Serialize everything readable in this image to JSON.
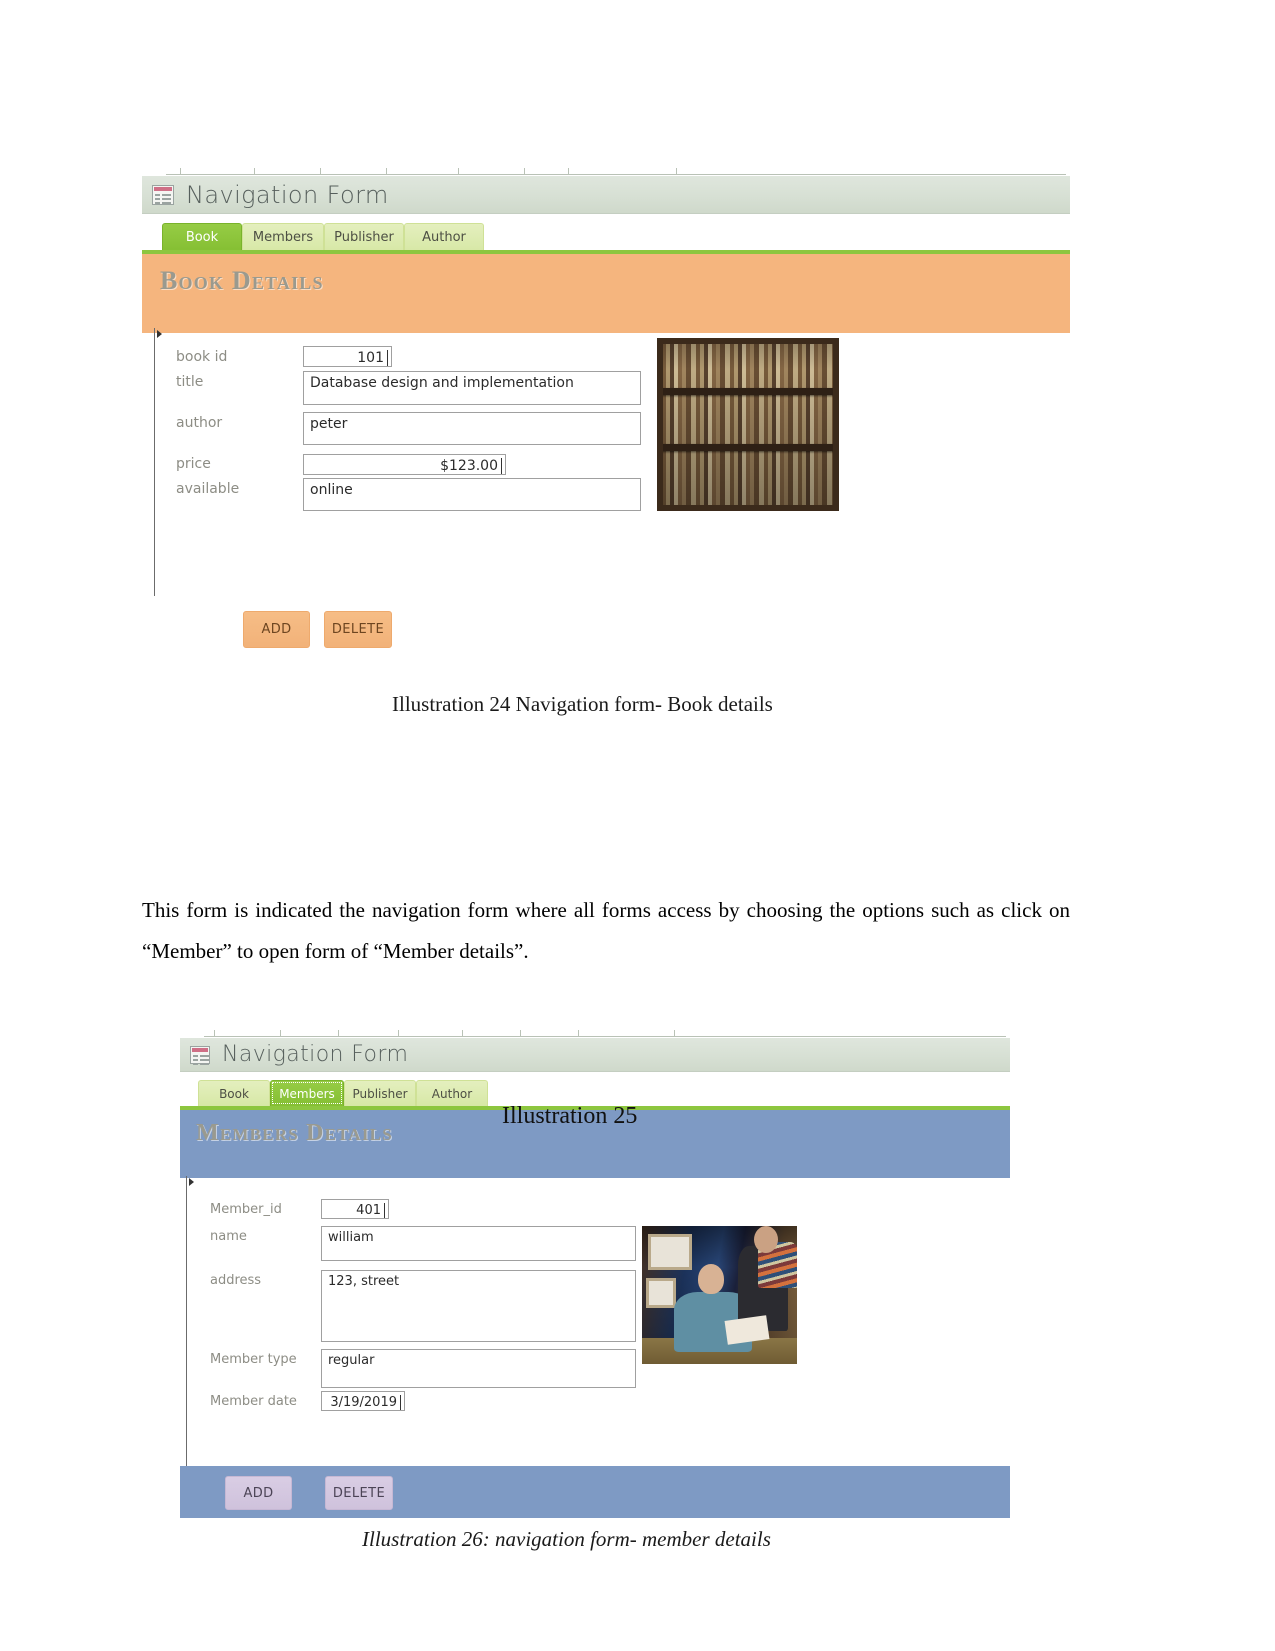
{
  "document": {
    "paragraph": "This form is indicated the navigation form where all forms access by choosing the options such as click on “Member”  to open form of “Member details”.",
    "caption_book": "Illustration 24 Navigation form- Book details",
    "caption_member": "Illustration 26: navigation form- member details",
    "overlay_illustration": "Illustration 25"
  },
  "book_form": {
    "window_title": "Navigation Form",
    "window_icon": "form-window-icon",
    "tabs": [
      {
        "label": "Book",
        "active": true
      },
      {
        "label": "Members",
        "active": false
      },
      {
        "label": "Publisher",
        "active": false
      },
      {
        "label": "Author",
        "active": false
      }
    ],
    "header_title": "Book Details",
    "header_color": "#f5b57e",
    "accent_color": "#8dc63f",
    "fields": [
      {
        "label": "book id",
        "value": "101",
        "align": "right"
      },
      {
        "label": "title",
        "value": "Database design and implementation",
        "align": "left"
      },
      {
        "label": "author",
        "value": "peter",
        "align": "left"
      },
      {
        "label": "price",
        "value": "$123.00",
        "align": "right"
      },
      {
        "label": "available",
        "value": "online",
        "align": "left"
      }
    ],
    "image_alt": "bookshelf-photo",
    "buttons": [
      {
        "label": "ADD"
      },
      {
        "label": "DELETE"
      }
    ]
  },
  "member_form": {
    "window_title": "Navigation Form",
    "window_icon": "form-window-icon",
    "tabs": [
      {
        "label": "Book",
        "active": false
      },
      {
        "label": "Members",
        "active": true
      },
      {
        "label": "Publisher",
        "active": false
      },
      {
        "label": "Author",
        "active": false
      }
    ],
    "header_title": "Members Details",
    "header_color": "#7e9ac4",
    "accent_color": "#8dc63f",
    "fields": [
      {
        "label": "Member_id",
        "value": "401",
        "align": "right"
      },
      {
        "label": "name",
        "value": "william",
        "align": "left"
      },
      {
        "label": "address",
        "value": "123, street",
        "align": "left"
      },
      {
        "label": "Member type",
        "value": "regular",
        "align": "left"
      },
      {
        "label": "Member date",
        "value": "3/19/2019",
        "align": "right"
      }
    ],
    "image_alt": "library-people-photo",
    "buttons": [
      {
        "label": "ADD"
      },
      {
        "label": "DELETE"
      }
    ]
  }
}
